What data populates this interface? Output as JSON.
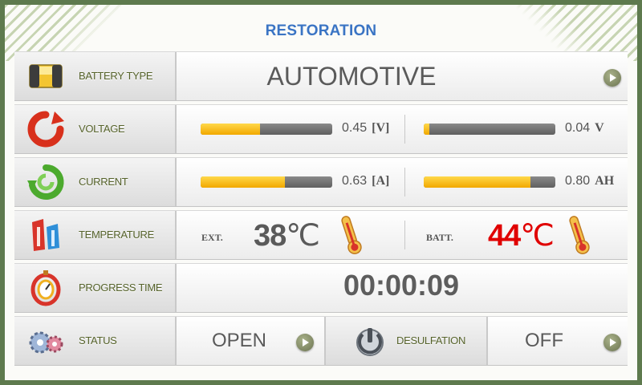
{
  "header": {
    "title": "RESTORATION"
  },
  "battery": {
    "label": "BATTERY TYPE",
    "value": "AUTOMOTIVE"
  },
  "voltage": {
    "label": "VOLTAGE",
    "left": {
      "value": "0.45",
      "unit": "[V]",
      "fill": 0.45
    },
    "right": {
      "value": "0.04",
      "unit": "V",
      "fill": 0.04
    }
  },
  "current": {
    "label": "CURRENT",
    "left": {
      "value": "0.63",
      "unit": "[A]",
      "fill": 0.64
    },
    "right": {
      "value": "0.80",
      "unit": "AH",
      "fill": 0.81
    }
  },
  "temperature": {
    "label": "TEMPERATURE",
    "ext_label": "EXT.",
    "ext_value": "38",
    "batt_label": "BATT.",
    "batt_value": "44",
    "unit": "℃",
    "ext_color": "#5a5a5a",
    "batt_color": "#e00000"
  },
  "progress": {
    "label": "PROGRESS TIME",
    "value": "00:00:09"
  },
  "status": {
    "label": "STATUS",
    "value": "OPEN"
  },
  "desulfation": {
    "label": "DESULFATION",
    "value": "OFF"
  },
  "colors": {
    "accent": "#3a74c4",
    "bar_fill": "#f2a800",
    "bar_track": "#6b6b6b",
    "frame": "#5e7a4e"
  },
  "icons": [
    "battery-icon",
    "voltage-icon",
    "current-icon",
    "temperature-icon",
    "progress-time-icon",
    "status-gears-icon",
    "desulfation-power-icon",
    "thermometer-icon",
    "play-icon"
  ]
}
